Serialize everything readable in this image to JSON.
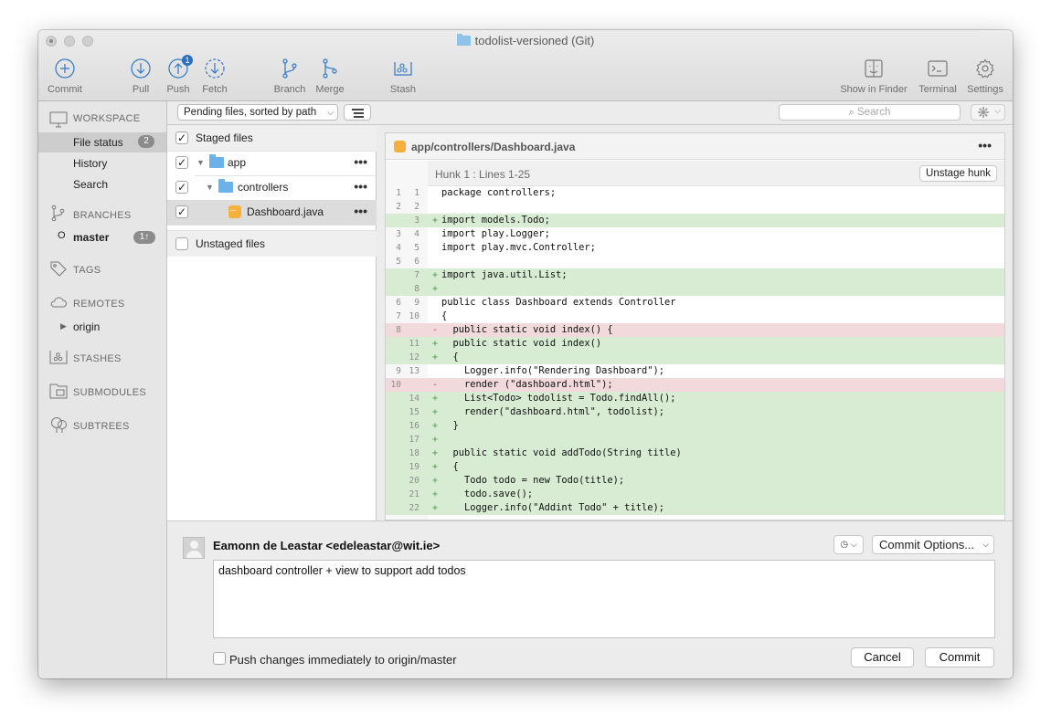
{
  "window": {
    "title": "todolist-versioned (Git)"
  },
  "toolbar": {
    "buttons": [
      {
        "label": "Commit",
        "icon": "commit-icon"
      },
      {
        "label": "Pull",
        "icon": "pull-icon"
      },
      {
        "label": "Push",
        "icon": "push-icon",
        "badge": "1"
      },
      {
        "label": "Fetch",
        "icon": "fetch-icon"
      },
      {
        "label": "Branch",
        "icon": "branch-icon"
      },
      {
        "label": "Merge",
        "icon": "merge-icon"
      },
      {
        "label": "Stash",
        "icon": "stash-icon"
      },
      {
        "label": "Show in Finder",
        "icon": "finder-icon"
      },
      {
        "label": "Terminal",
        "icon": "terminal-icon"
      },
      {
        "label": "Settings",
        "icon": "gear-icon"
      }
    ]
  },
  "sidebar": {
    "workspace": "WORKSPACE",
    "file_status": "File status",
    "file_status_count": "2",
    "history": "History",
    "search": "Search",
    "branches": "BRANCHES",
    "master": "master",
    "master_badge": "1↑",
    "tags": "TAGS",
    "remotes": "REMOTES",
    "origin": "origin",
    "stashes": "STASHES",
    "submodules": "SUBMODULES",
    "subtrees": "SUBTREES"
  },
  "filter": {
    "sort_label": "Pending files, sorted by path",
    "search_placeholder": "Search"
  },
  "files": {
    "staged_header": "Staged files",
    "app": "app",
    "controllers": "controllers",
    "dashboard": "Dashboard.java",
    "unstaged_header": "Unstaged files"
  },
  "diff": {
    "path": "app/controllers/Dashboard.java",
    "hunk_title": "Hunk 1 : Lines 1-25",
    "unstage_label": "Unstage hunk",
    "lines": [
      {
        "old": "1",
        "new": "1",
        "type": "ctx",
        "text": "package controllers;"
      },
      {
        "old": "2",
        "new": "2",
        "type": "ctx",
        "text": ""
      },
      {
        "old": "",
        "new": "3",
        "type": "add",
        "text": "import models.Todo;"
      },
      {
        "old": "3",
        "new": "4",
        "type": "ctx",
        "text": "import play.Logger;"
      },
      {
        "old": "4",
        "new": "5",
        "type": "ctx",
        "text": "import play.mvc.Controller;"
      },
      {
        "old": "5",
        "new": "6",
        "type": "ctx",
        "text": ""
      },
      {
        "old": "",
        "new": "7",
        "type": "add",
        "text": "import java.util.List;"
      },
      {
        "old": "",
        "new": "8",
        "type": "add",
        "text": ""
      },
      {
        "old": "6",
        "new": "9",
        "type": "ctx",
        "text": "public class Dashboard extends Controller"
      },
      {
        "old": "7",
        "new": "10",
        "type": "ctx",
        "text": "{"
      },
      {
        "old": "8",
        "new": "",
        "type": "del",
        "text": "  public static void index() {"
      },
      {
        "old": "",
        "new": "11",
        "type": "add",
        "text": "  public static void index()"
      },
      {
        "old": "",
        "new": "12",
        "type": "add",
        "text": "  {"
      },
      {
        "old": "9",
        "new": "13",
        "type": "ctx",
        "text": "    Logger.info(\"Rendering Dashboard\");"
      },
      {
        "old": "10",
        "new": "",
        "type": "del",
        "text": "    render (\"dashboard.html\");"
      },
      {
        "old": "",
        "new": "14",
        "type": "add",
        "text": "    List<Todo> todolist = Todo.findAll();"
      },
      {
        "old": "",
        "new": "15",
        "type": "add",
        "text": "    render(\"dashboard.html\", todolist);"
      },
      {
        "old": "",
        "new": "16",
        "type": "add",
        "text": "  }"
      },
      {
        "old": "",
        "new": "17",
        "type": "add",
        "text": ""
      },
      {
        "old": "",
        "new": "18",
        "type": "add",
        "text": "  public static void addTodo(String title)"
      },
      {
        "old": "",
        "new": "19",
        "type": "add",
        "text": "  {"
      },
      {
        "old": "",
        "new": "20",
        "type": "add",
        "text": "    Todo todo = new Todo(title);"
      },
      {
        "old": "",
        "new": "21",
        "type": "add",
        "text": "    todo.save();"
      },
      {
        "old": "",
        "new": "22",
        "type": "add",
        "text": "    Logger.info(\"Addint Todo\" + title);"
      }
    ]
  },
  "commit": {
    "author": "Eamonn de Leastar <edeleastar@wit.ie>",
    "options_label": "Commit Options...",
    "message": "dashboard controller + view to support add todos",
    "push_label": "Push changes immediately to origin/master",
    "cancel_label": "Cancel",
    "commit_label": "Commit"
  }
}
